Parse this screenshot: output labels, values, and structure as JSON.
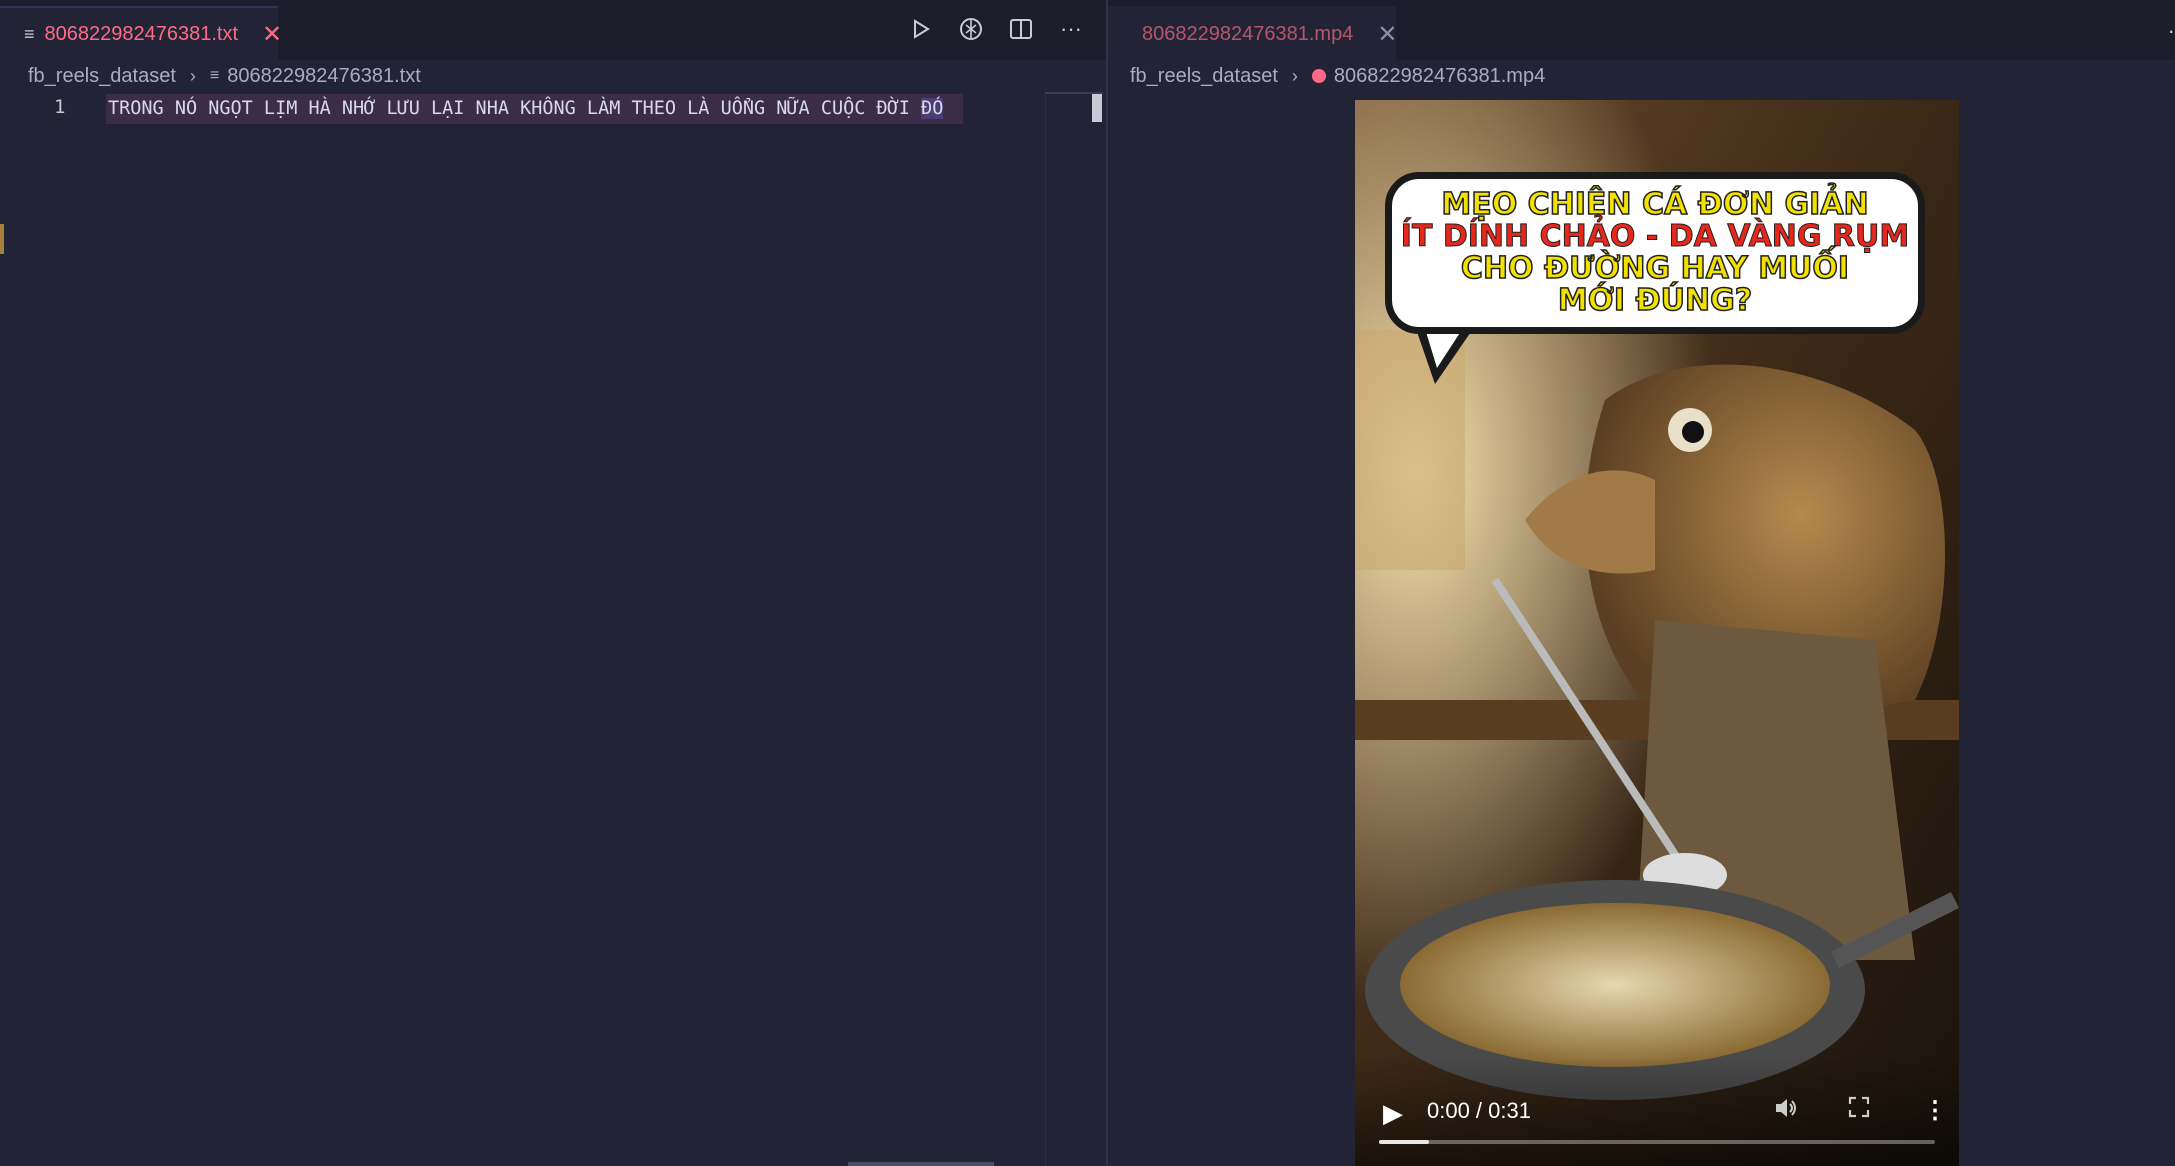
{
  "left_pane": {
    "tab": {
      "label": "806822982476381.txt",
      "icon": "text-file-icon"
    },
    "breadcrumb": {
      "folder": "fb_reels_dataset",
      "file": "806822982476381.txt"
    },
    "editor": {
      "line_number": "1",
      "line_text": "TRONG NÓ NGỌT LỊM HÀ NHỚ LƯU LẠI NHA KHÔNG LÀM THEO LÀ UỔNG NỮA CUỘC ĐỜI ",
      "selected_word": "ĐÓ"
    },
    "toolbar": [
      "run-icon",
      "copilot-icon",
      "split-editor-icon",
      "more-actions-icon"
    ]
  },
  "right_pane": {
    "tab": {
      "label": "806822982476381.mp4",
      "icon": "video-file-icon"
    },
    "breadcrumb": {
      "folder": "fb_reels_dataset",
      "file": "806822982476381.mp4"
    },
    "video": {
      "caption_line1": "MẸO CHIÊN CÁ ĐƠN GIẢN",
      "caption_line2": "ÍT DÍNH CHẢO - DA VÀNG RỤM",
      "caption_line3": "CHO ĐƯỜNG HAY MUỐI",
      "caption_line4": "MỚI ĐÚNG?",
      "time": "0:00 / 0:31",
      "progress": 0.09
    }
  },
  "colors": {
    "accent": "#ff6b86",
    "background": "#222436",
    "selection": "#4a3d76"
  }
}
